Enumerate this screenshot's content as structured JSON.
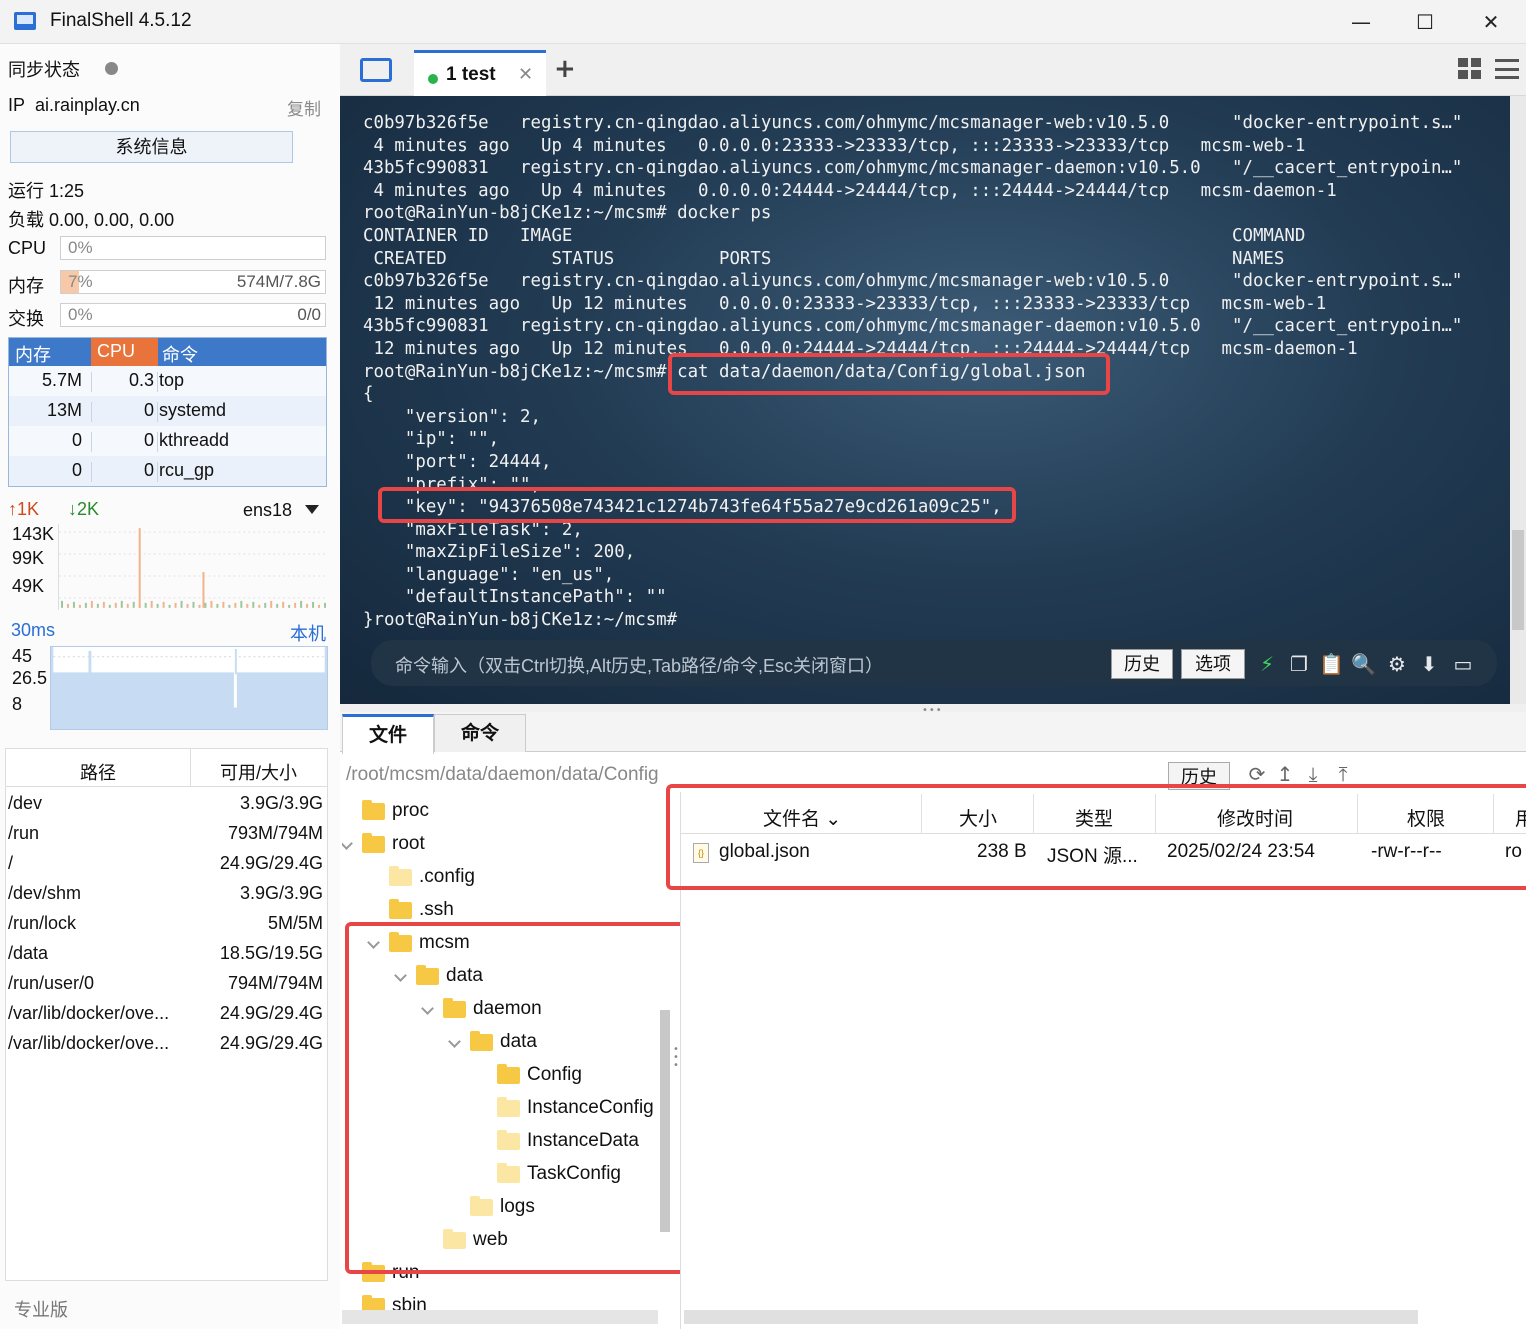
{
  "window": {
    "title": "FinalShell 4.5.12",
    "minimize": "—",
    "maximize": "☐",
    "close": "✕"
  },
  "left": {
    "sync_label": "同步状态",
    "ip_label": "IP",
    "ip_value": "ai.rainplay.cn",
    "copy_label": "复制",
    "sysinfo_button": "系统信息",
    "uptime": "运行 1:25",
    "load": "负载 0.00, 0.00, 0.00",
    "cpu": {
      "label": "CPU",
      "pct": "0%",
      "fill": 0
    },
    "mem": {
      "label": "内存",
      "pct": "7%",
      "fill": 0.07,
      "detail": "574M/7.8G"
    },
    "swap": {
      "label": "交换",
      "pct": "0%",
      "fill": 0,
      "detail": "0/0"
    },
    "proc_headers": {
      "mem": "内存",
      "cpu": "CPU",
      "cmd": "命令"
    },
    "processes": [
      {
        "mem": "5.7M",
        "cpu": "0.3",
        "cmd": "top"
      },
      {
        "mem": "13M",
        "cpu": "0",
        "cmd": "systemd"
      },
      {
        "mem": "0",
        "cpu": "0",
        "cmd": "kthreadd"
      },
      {
        "mem": "0",
        "cpu": "0",
        "cmd": "rcu_gp"
      }
    ],
    "net": {
      "up": "↑1K",
      "down": "↓2K",
      "iface": "ens18",
      "y_labels": [
        "143K",
        "99K",
        "49K"
      ]
    },
    "ping": {
      "label": "30ms",
      "host": "本机",
      "y_labels": [
        "45",
        "26.5",
        "8"
      ]
    },
    "disk_headers": {
      "path": "路径",
      "size": "可用/大小"
    },
    "disks": [
      {
        "path": "/dev",
        "size": "3.9G/3.9G"
      },
      {
        "path": "/run",
        "size": "793M/794M"
      },
      {
        "path": "/",
        "size": "24.9G/29.4G"
      },
      {
        "path": "/dev/shm",
        "size": "3.9G/3.9G"
      },
      {
        "path": "/run/lock",
        "size": "5M/5M"
      },
      {
        "path": "/data",
        "size": "18.5G/19.5G"
      },
      {
        "path": "/run/user/0",
        "size": "794M/794M"
      },
      {
        "path": "/var/lib/docker/ove...",
        "size": "24.9G/29.4G"
      },
      {
        "path": "/var/lib/docker/ove...",
        "size": "24.9G/29.4G"
      }
    ],
    "edition": "专业版"
  },
  "tabs": {
    "session_label": "1 test",
    "close": "✕",
    "add": "+"
  },
  "terminal": {
    "lines": [
      "c0b97b326f5e   registry.cn-qingdao.aliyuncs.com/ohmymc/mcsmanager-web:v10.5.0      \"docker-entrypoint.s…\"",
      " 4 minutes ago   Up 4 minutes   0.0.0.0:23333->23333/tcp, :::23333->23333/tcp   mcsm-web-1",
      "43b5fc990831   registry.cn-qingdao.aliyuncs.com/ohmymc/mcsmanager-daemon:v10.5.0   \"/__cacert_entrypoin…\"",
      " 4 minutes ago   Up 4 minutes   0.0.0.0:24444->24444/tcp, :::24444->24444/tcp   mcsm-daemon-1",
      "root@RainYun-b8jCKe1z:~/mcsm# docker ps",
      "CONTAINER ID   IMAGE                                                               COMMAND",
      " CREATED          STATUS          PORTS                                            NAMES",
      "c0b97b326f5e   registry.cn-qingdao.aliyuncs.com/ohmymc/mcsmanager-web:v10.5.0      \"docker-entrypoint.s…\"",
      " 12 minutes ago   Up 12 minutes   0.0.0.0:23333->23333/tcp, :::23333->23333/tcp   mcsm-web-1",
      "43b5fc990831   registry.cn-qingdao.aliyuncs.com/ohmymc/mcsmanager-daemon:v10.5.0   \"/__cacert_entrypoin…\"",
      " 12 minutes ago   Up 12 minutes   0.0.0.0:24444->24444/tcp, :::24444->24444/tcp   mcsm-daemon-1",
      "root@RainYun-b8jCKe1z:~/mcsm# cat data/daemon/data/Config/global.json",
      "{",
      "    \"version\": 2,",
      "    \"ip\": \"\",",
      "    \"port\": 24444,",
      "    \"prefix\": \"\",",
      "    \"key\": \"94376508e743421c1274b743fe64f55a27e9cd261a09c25\",",
      "    \"maxFileTask\": 2,",
      "    \"maxZipFileSize\": 200,",
      "    \"language\": \"en_us\",",
      "    \"defaultInstancePath\": \"\"",
      "}root@RainYun-b8jCKe1z:~/mcsm# "
    ],
    "cmd_placeholder": "命令输入（双击Ctrl切换,Alt历史,Tab路径/命令,Esc关闭窗口）",
    "history_button": "历史",
    "options_button": "选项"
  },
  "files": {
    "tab_files": "文件",
    "tab_commands": "命令",
    "path": "/root/mcsm/data/daemon/data/Config",
    "history_button": "历史",
    "tree": [
      {
        "label": "proc",
        "depth": 0,
        "expanded": null,
        "light": false
      },
      {
        "label": "root",
        "depth": 0,
        "expanded": true,
        "light": false
      },
      {
        "label": ".config",
        "depth": 1,
        "expanded": null,
        "light": true
      },
      {
        "label": ".ssh",
        "depth": 1,
        "expanded": null,
        "light": false
      },
      {
        "label": "mcsm",
        "depth": 1,
        "expanded": true,
        "light": false
      },
      {
        "label": "data",
        "depth": 2,
        "expanded": true,
        "light": false
      },
      {
        "label": "daemon",
        "depth": 3,
        "expanded": true,
        "light": false
      },
      {
        "label": "data",
        "depth": 4,
        "expanded": true,
        "light": false
      },
      {
        "label": "Config",
        "depth": 5,
        "expanded": null,
        "light": false
      },
      {
        "label": "InstanceConfig",
        "depth": 5,
        "expanded": null,
        "light": true
      },
      {
        "label": "InstanceData",
        "depth": 5,
        "expanded": null,
        "light": true
      },
      {
        "label": "TaskConfig",
        "depth": 5,
        "expanded": null,
        "light": true
      },
      {
        "label": "logs",
        "depth": 4,
        "expanded": null,
        "light": true
      },
      {
        "label": "web",
        "depth": 3,
        "expanded": null,
        "light": true
      },
      {
        "label": "run",
        "depth": 0,
        "expanded": null,
        "light": false
      },
      {
        "label": "sbin",
        "depth": 0,
        "expanded": null,
        "light": false
      }
    ],
    "columns": {
      "name": "文件名",
      "size": "大小",
      "type": "类型",
      "mtime": "修改时间",
      "perm": "权限",
      "owner": "用"
    },
    "rows": [
      {
        "name": "global.json",
        "size": "238 B",
        "type": "JSON 源...",
        "mtime": "2025/02/24 23:54",
        "perm": "-rw-r--r--",
        "owner": "ro"
      }
    ]
  },
  "colors": {
    "accent": "#2a6ed6",
    "highlight_box": "#e84646",
    "proc_header": "#3d79c8",
    "proc_header_sorted": "#e8733b"
  }
}
